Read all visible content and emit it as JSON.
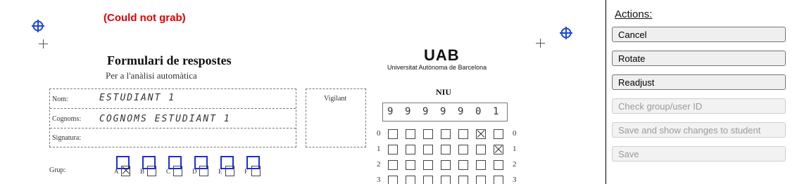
{
  "scan": {
    "error": "(Could not grab)",
    "form_title": "Formulari de respostes",
    "form_subtitle": "Per a l'anàlisi automàtica",
    "fields": {
      "nom_label": "Nom:",
      "nom_value": "ESTUDIANT 1",
      "cognoms_label": "Cognoms:",
      "cognoms_value": "COGNOMS ESTUDIANT 1",
      "signatura_label": "Signatura:"
    },
    "vigilant_label": "Vigilant",
    "grup_label": "Grup:",
    "groups": [
      "A",
      "B",
      "C",
      "D",
      "E",
      "F"
    ],
    "logo": "UAB",
    "university": "Universitat Autònoma de Barcelona",
    "niu_label": "NIU",
    "niu_digits": [
      "9",
      "9",
      "9",
      "9",
      "9",
      "0",
      "1"
    ],
    "bubble_rows": [
      {
        "label": "0",
        "marked": 5
      },
      {
        "label": "1",
        "marked": 6
      },
      {
        "label": "2",
        "marked": -1
      },
      {
        "label": "3",
        "marked": -1
      }
    ]
  },
  "colors": {
    "error": "#e10000",
    "marker": "#1646d8"
  },
  "actions": {
    "title": "Actions:",
    "buttons": [
      {
        "label": "Cancel",
        "enabled": true
      },
      {
        "label": "Rotate",
        "enabled": true
      },
      {
        "label": "Readjust",
        "enabled": true
      },
      {
        "label": "Check group/user ID",
        "enabled": false
      },
      {
        "label": "Save and show changes to student",
        "enabled": false
      },
      {
        "label": "Save",
        "enabled": false
      }
    ]
  }
}
